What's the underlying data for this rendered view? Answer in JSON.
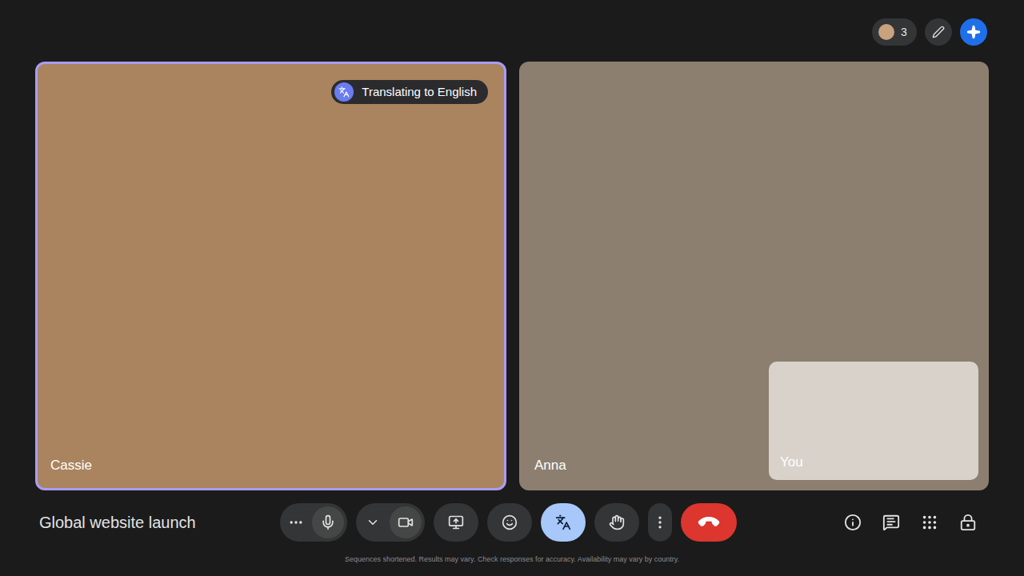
{
  "meeting": {
    "title": "Global website launch"
  },
  "top_bar": {
    "participant_count": "3"
  },
  "tiles": [
    {
      "name": "Cassie",
      "speaking": true,
      "badge": "Translating to English",
      "photo": "#a9845e"
    },
    {
      "name": "Anna",
      "speaking": false,
      "badge": "",
      "photo": "#8c7f70"
    }
  ],
  "self_view": {
    "name": "You"
  },
  "controls": [
    {
      "kind": "audio",
      "selected": false
    },
    {
      "kind": "camera",
      "selected": false
    },
    {
      "kind": "present",
      "selected": false
    },
    {
      "kind": "reactions",
      "selected": false
    },
    {
      "kind": "translate",
      "selected": true
    },
    {
      "kind": "raise-hand",
      "selected": false
    },
    {
      "kind": "more",
      "selected": false
    },
    {
      "kind": "leave",
      "selected": false
    }
  ],
  "side_controls": [
    {
      "kind": "info"
    },
    {
      "kind": "chat"
    },
    {
      "kind": "activities"
    },
    {
      "kind": "host-controls"
    }
  ],
  "footer": "Sequences shortened. Results may vary. Check responses for accuracy. Availability may vary by country."
}
